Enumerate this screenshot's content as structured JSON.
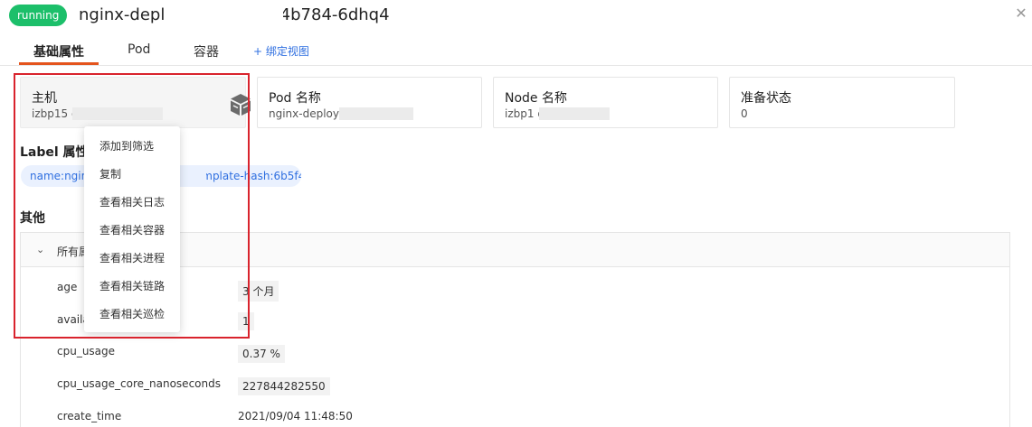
{
  "header": {
    "status": "running",
    "title": "nginx-deployment-6b5f44b784-6dhq4",
    "close_glyph": "✕"
  },
  "tabs": [
    {
      "label": "基础属性"
    },
    {
      "label": "Pod"
    },
    {
      "label": "容器"
    }
  ],
  "add_view_label": "+ 绑定视图",
  "cards": [
    {
      "label": "主机",
      "value": "izbp15                       du15z",
      "icon": "cube-icon"
    },
    {
      "label": "Pod 名称",
      "value": "nginx-deploy                         6dhq4"
    },
    {
      "label": "Node 名称",
      "value": "izbp1                              du15z"
    },
    {
      "label": "准备状态",
      "value": "0"
    }
  ],
  "labels_section": {
    "title": "Label 属性",
    "chip": "name:nginx-deployment   pod-template-hash:6b5f44b784"
  },
  "other_section": {
    "title": "其他",
    "panel_title": "所有属性",
    "rows": [
      {
        "key": "age",
        "value": "3 个月"
      },
      {
        "key": "available",
        "value": "1"
      },
      {
        "key": "cpu_usage",
        "value": "0.37 %"
      },
      {
        "key": "cpu_usage_core_nanoseconds",
        "value": "227844282550"
      },
      {
        "key": "create_time",
        "value": "2021/09/04 11:48:50"
      }
    ]
  },
  "context_menu": {
    "items": [
      {
        "label": "添加到筛选"
      },
      {
        "label": "复制"
      },
      {
        "label": "查看相关日志"
      },
      {
        "label": "查看相关容器"
      },
      {
        "label": "查看相关进程"
      },
      {
        "label": "查看相关链路"
      },
      {
        "label": "查看相关巡检"
      }
    ]
  },
  "colors": {
    "status": "#1cbf6a",
    "tab_accent": "#e4541d",
    "link": "#2f6fe0",
    "highlight": "#d9232d"
  }
}
